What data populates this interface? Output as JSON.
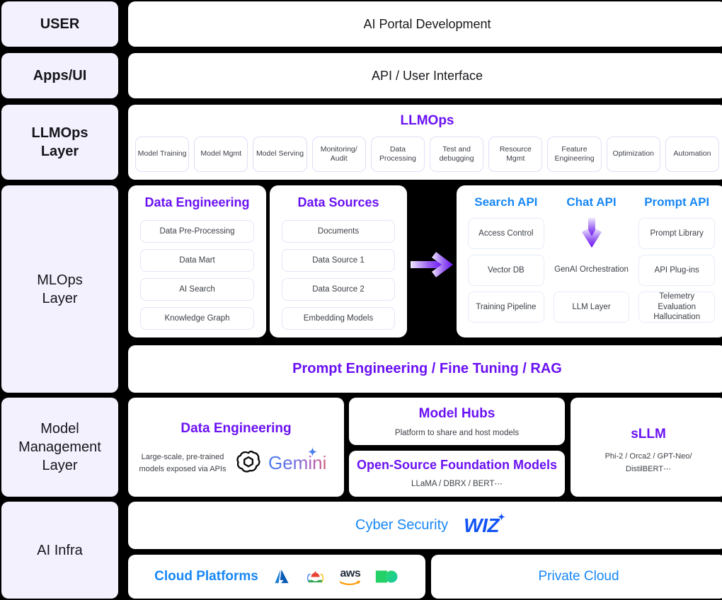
{
  "colors": {
    "sidebar_bg": "#f4f1fe",
    "purple": "#6a11f4",
    "blue": "#1787f5",
    "background": "#000000",
    "panel": "#ffffff"
  },
  "sidebar": {
    "items": [
      {
        "label": "USER"
      },
      {
        "label": "Apps/UI"
      },
      {
        "label": "LLMOps\nLayer"
      },
      {
        "label": "MLOps\nLayer"
      },
      {
        "label": "Model\nManagement\nLayer"
      },
      {
        "label": "AI Infra"
      }
    ]
  },
  "rows": {
    "user": {
      "title": "AI Portal Development"
    },
    "apps_ui": {
      "title": "API / User Interface"
    },
    "llmops": {
      "title": "LLMOps",
      "chips": [
        "Model Training",
        "Model Mgmt",
        "Model Serving",
        "Monitoring/ Audit",
        "Data Processing",
        "Test and debugging",
        "Resource Mgmt",
        "Feature Engineering",
        "Optimization",
        "Automation"
      ]
    },
    "mlops": {
      "data_engineering": {
        "title": "Data Engineering",
        "items": [
          "Data Pre-Processing",
          "Data Mart",
          "AI Search",
          "Knowledge Graph"
        ]
      },
      "data_sources": {
        "title": "Data Sources",
        "items": [
          "Documents",
          "Data Source 1",
          "Data Source 2",
          "Embedding Models"
        ]
      },
      "arrow": {
        "name": "right-arrow"
      },
      "apis": {
        "columns": [
          {
            "title": "Search API",
            "items": [
              "Access Control",
              "Vector DB",
              "Training Pipeline"
            ]
          },
          {
            "title": "Chat API",
            "items": [
              "GenAI Orchestration",
              "LLM Layer"
            ],
            "has_down_arrow": true
          },
          {
            "title": "Prompt API",
            "items": [
              "Prompt Library",
              "API Plug-ins",
              "Telemetry Evaluation Hallucination"
            ]
          }
        ]
      }
    },
    "prompt_engineering": {
      "title": "Prompt Engineering / Fine Tuning / RAG"
    },
    "model_management": {
      "data_engineering": {
        "title": "Data Engineering",
        "caption": "Large-scale, pre-trained models exposed via APIs",
        "logos": [
          "openai-logo",
          "gemini-logo"
        ],
        "gemini_text": "Gemini"
      },
      "model_hubs": {
        "title": "Model Hubs",
        "caption": "Platform to share and host models"
      },
      "open_source": {
        "title": "Open-Source Foundation Models",
        "caption": "LLaMA / DBRX / BERT⋯"
      },
      "sllm": {
        "title": "sLLM",
        "caption": "Phi-2 / Orca2 / GPT-Neo/ DistilBERT⋯"
      }
    },
    "ai_infra": {
      "cyber_security": {
        "title": "Cyber Security",
        "logo_text": "WIZ"
      },
      "cloud_platforms": {
        "title": "Cloud Platforms",
        "logos": [
          "azure-logo",
          "google-cloud-logo",
          "aws-logo",
          "naver-cloud-logo"
        ],
        "aws_text": "aws"
      },
      "private_cloud": {
        "title": "Private Cloud"
      }
    }
  }
}
